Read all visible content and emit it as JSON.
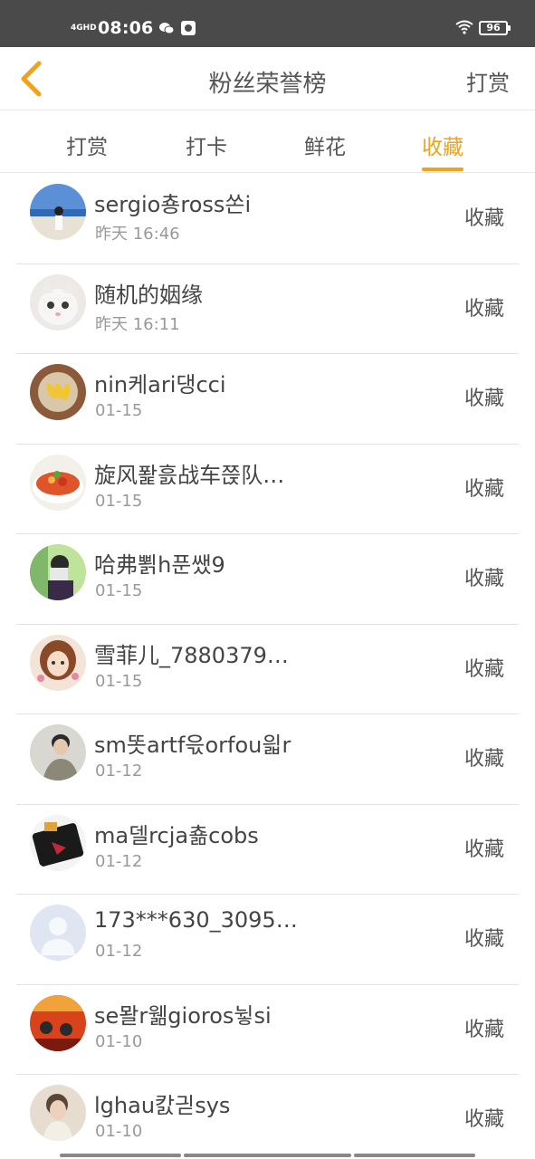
{
  "status_bar": {
    "network": "4GHD",
    "time": "08:06",
    "battery": "96",
    "icons": [
      "signal-icon",
      "wechat-icon",
      "qq-icon",
      "wifi-icon",
      "battery-icon"
    ]
  },
  "nav": {
    "title": "粉丝荣誉榜",
    "action_label": "打赏",
    "back_icon": "chevron-left-icon",
    "accent_color": "#f0a21a"
  },
  "tabs": [
    {
      "label": "打赏",
      "active": false
    },
    {
      "label": "打卡",
      "active": false
    },
    {
      "label": "鲜花",
      "active": false
    },
    {
      "label": "收藏",
      "active": true
    }
  ],
  "fans": [
    {
      "name": "sergio춍ross쏜i",
      "time": "昨天 16:46",
      "action": "收藏"
    },
    {
      "name": "随机的姻缘",
      "time": "昨天 16:11",
      "action": "收藏"
    },
    {
      "name": "nin케ari댕cci",
      "time": "01-15",
      "action": "收藏"
    },
    {
      "name": "旋风퐕흜战车쯙队…",
      "time": "01-15",
      "action": "收藏"
    },
    {
      "name": "哈弗뾝h푼쌨9",
      "time": "01-15",
      "action": "收藏"
    },
    {
      "name": "雪菲儿_7880379…",
      "time": "01-15",
      "action": "收藏"
    },
    {
      "name": "sm똣artf윿orfou읣r",
      "time": "01-12",
      "action": "收藏"
    },
    {
      "name": "ma델rcja춂cobs",
      "time": "01-12",
      "action": "收藏"
    },
    {
      "name": "173***630_3095…",
      "time": "01-12",
      "action": "收藏"
    },
    {
      "name": "se뫌r웲gioros뉳si",
      "time": "01-10",
      "action": "收藏"
    },
    {
      "name": "lghau캀긛sys",
      "time": "01-10",
      "action": "收藏"
    }
  ]
}
